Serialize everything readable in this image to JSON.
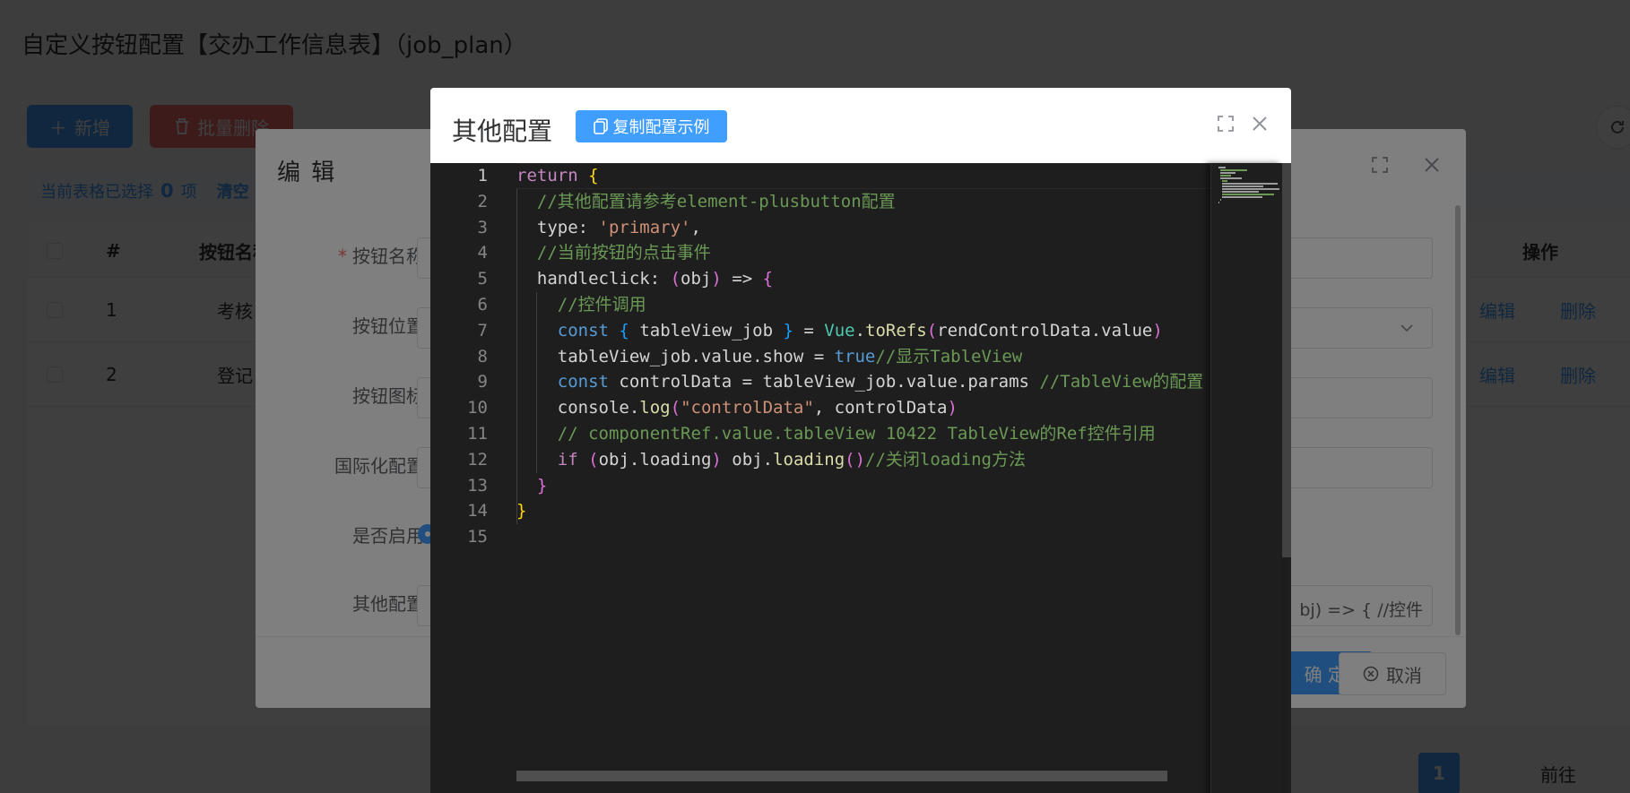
{
  "page": {
    "title": "自定义按钮配置【交办工作信息表】（job_plan）",
    "add_label": "新增",
    "bulk_delete_label": "批量删除",
    "selection": {
      "prefix": "当前表格已选择",
      "count": "0",
      "suffix": "项",
      "clear": "清空"
    },
    "table": {
      "headers": {
        "index": "#",
        "name": "按钮名称",
        "ops": "操作"
      },
      "rows": [
        {
          "index": "1",
          "name": "考核",
          "edit": "编辑",
          "delete": "删除"
        },
        {
          "index": "2",
          "name": "登记",
          "edit": "编辑",
          "delete": "删除"
        }
      ]
    },
    "pager": {
      "current": "1",
      "goto": "前往"
    }
  },
  "edit_dialog": {
    "title": "编 辑",
    "fields": {
      "name_label": "按钮名称",
      "position_label": "按钮位置",
      "icon_label": "按钮图标",
      "i18n_label": "国际化配置",
      "enabled_label": "是否启用",
      "other_label": "其他配置",
      "other_value": "bj) => {    //控件"
    },
    "confirm": "确 定",
    "cancel": "取消"
  },
  "config_dialog": {
    "title": "其他配置",
    "copy_button": "复制配置示例",
    "lines": [
      "return {",
      "  //其他配置请参考element-plusbutton配置",
      "  type: 'primary',",
      "  //当前按钮的点击事件",
      "  handleclick: (obj) => {",
      "    //控件调用",
      "    const { tableView_job } = Vue.toRefs(rendControlData.value)",
      "    tableView_job.value.show = true//显示TableView",
      "    const controlData = tableView_job.value.params //TableView的配置",
      "    console.log(\"controlData\", controlData)",
      "    // componentRef.value.tableView 10422 TableView的Ref控件引用",
      "    if (obj.loading) obj.loading()//关闭loading方法",
      "  }",
      "}",
      ""
    ],
    "line_numbers": [
      "1",
      "2",
      "3",
      "4",
      "5",
      "6",
      "7",
      "8",
      "9",
      "10",
      "11",
      "12",
      "13",
      "14",
      "15"
    ]
  },
  "colors": {
    "primary": "#409eff",
    "danger": "#f56c6c",
    "editor_bg": "#1e1e1e",
    "keyword": "#569cd6",
    "comment": "#6a9955",
    "string": "#ce9178"
  }
}
